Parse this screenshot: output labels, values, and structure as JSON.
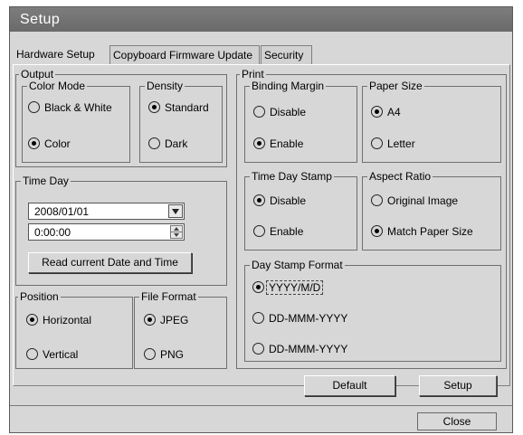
{
  "window": {
    "title": "Setup"
  },
  "tabs": [
    {
      "label": "Hardware Setup",
      "active": true
    },
    {
      "label": "Copyboard Firmware Update",
      "active": false
    },
    {
      "label": "Security",
      "active": false
    }
  ],
  "output": {
    "label": "Output",
    "color_mode": {
      "label": "Color Mode",
      "options": [
        {
          "label": "Black & White",
          "selected": false
        },
        {
          "label": "Color",
          "selected": true
        }
      ]
    },
    "density": {
      "label": "Density",
      "options": [
        {
          "label": "Standard",
          "selected": true
        },
        {
          "label": "Dark",
          "selected": false
        }
      ]
    }
  },
  "time_day": {
    "label": "Time Day",
    "date_value": "2008/01/01",
    "time_value": "0:00:00",
    "read_button": "Read current Date and Time"
  },
  "position": {
    "label": "Position",
    "options": [
      {
        "label": "Horizontal",
        "selected": true
      },
      {
        "label": "Vertical",
        "selected": false
      }
    ]
  },
  "file_format": {
    "label": "File Format",
    "options": [
      {
        "label": "JPEG",
        "selected": true
      },
      {
        "label": "PNG",
        "selected": false
      }
    ]
  },
  "print": {
    "label": "Print",
    "binding_margin": {
      "label": "Binding Margin",
      "options": [
        {
          "label": "Disable",
          "selected": false
        },
        {
          "label": "Enable",
          "selected": true
        }
      ]
    },
    "paper_size": {
      "label": "Paper Size",
      "options": [
        {
          "label": "A4",
          "selected": true
        },
        {
          "label": "Letter",
          "selected": false
        }
      ]
    },
    "time_day_stamp": {
      "label": "Time Day Stamp",
      "options": [
        {
          "label": "Disable",
          "selected": true
        },
        {
          "label": "Enable",
          "selected": false
        }
      ]
    },
    "aspect_ratio": {
      "label": "Aspect Ratio",
      "options": [
        {
          "label": "Original Image",
          "selected": false
        },
        {
          "label": "Match Paper Size",
          "selected": true
        }
      ]
    },
    "day_stamp_format": {
      "label": "Day Stamp Format",
      "options": [
        {
          "label": "YYYY/M/D",
          "selected": true
        },
        {
          "label": "DD-MMM-YYYY",
          "selected": false
        },
        {
          "label": "DD-MMM-YYYY",
          "selected": false
        }
      ]
    }
  },
  "buttons": {
    "default": "Default",
    "setup": "Setup",
    "close": "Close"
  }
}
